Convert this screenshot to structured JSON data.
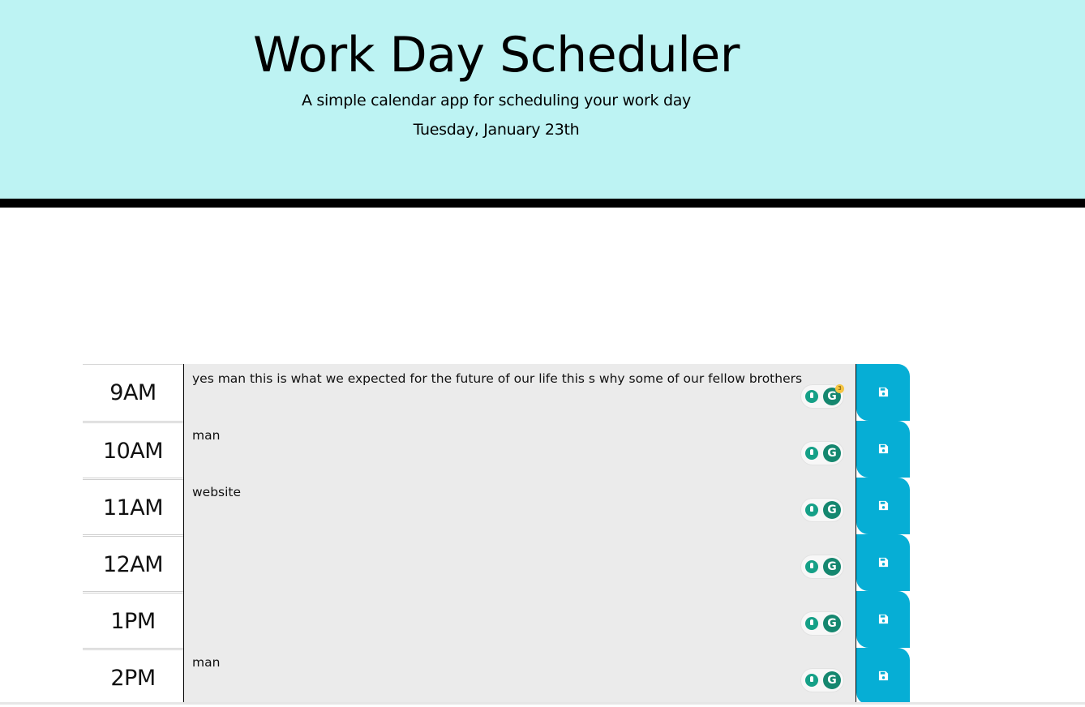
{
  "header": {
    "title": "Work Day Scheduler",
    "subtitle": "A simple calendar app for scheduling your work day",
    "current_day": "Tuesday, January 23th",
    "background_color": "#bdf3f3",
    "border_color": "#000000"
  },
  "time_blocks": [
    {
      "hour": "9AM",
      "text": "yes man this is what we expected for the future of our life this s why some of our fellow brothers",
      "grammarly_badge": "3"
    },
    {
      "hour": "10AM",
      "text": "man",
      "grammarly_badge": ""
    },
    {
      "hour": "11AM",
      "text": "website",
      "grammarly_badge": ""
    },
    {
      "hour": "12AM",
      "text": "",
      "grammarly_badge": ""
    },
    {
      "hour": "1PM",
      "text": "",
      "grammarly_badge": ""
    },
    {
      "hour": "2PM",
      "text": "man",
      "grammarly_badge": ""
    }
  ],
  "colors": {
    "description_bg": "#ebebeb",
    "save_button": "#06aed5",
    "grammarly_green": "#15876f"
  },
  "icons": {
    "save": "floppy-disk-icon",
    "grammarly_bulb": "lightbulb-icon",
    "grammarly_logo": "grammarly-g-icon",
    "grammarly_glyph": "G"
  }
}
